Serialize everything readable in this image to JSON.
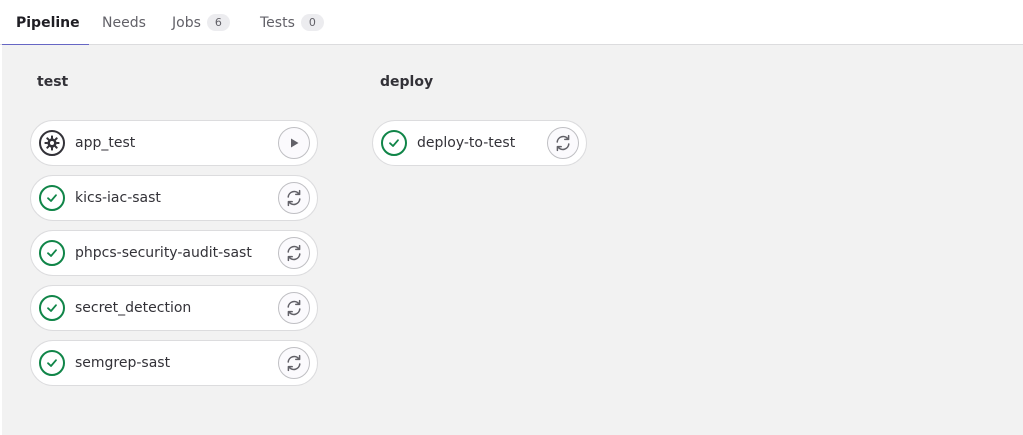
{
  "tabs": [
    {
      "label": "Pipeline",
      "active": true
    },
    {
      "label": "Needs"
    },
    {
      "label": "Jobs",
      "count": "6"
    },
    {
      "label": "Tests",
      "count": "0"
    }
  ],
  "stages": [
    {
      "title": "test",
      "jobs": [
        {
          "name": "app_test",
          "status": "manual",
          "status_icon": "gear-icon",
          "action_icon": "play-icon"
        },
        {
          "name": "kics-iac-sast",
          "status": "success",
          "status_icon": "check-icon",
          "action_icon": "retry-icon"
        },
        {
          "name": "phpcs-security-audit-sast",
          "status": "success",
          "status_icon": "check-icon",
          "action_icon": "retry-icon"
        },
        {
          "name": "secret_detection",
          "status": "success",
          "status_icon": "check-icon",
          "action_icon": "retry-icon"
        },
        {
          "name": "semgrep-sast",
          "status": "success",
          "status_icon": "check-icon",
          "action_icon": "retry-icon"
        }
      ]
    },
    {
      "title": "deploy",
      "jobs": [
        {
          "name": "deploy-to-test",
          "status": "success",
          "status_icon": "check-icon",
          "action_icon": "retry-icon"
        }
      ]
    }
  ],
  "colors": {
    "success": "#108548",
    "manual": "#333238",
    "tab_underline": "#6666c4",
    "canvas_bg": "#f2f2f2"
  }
}
